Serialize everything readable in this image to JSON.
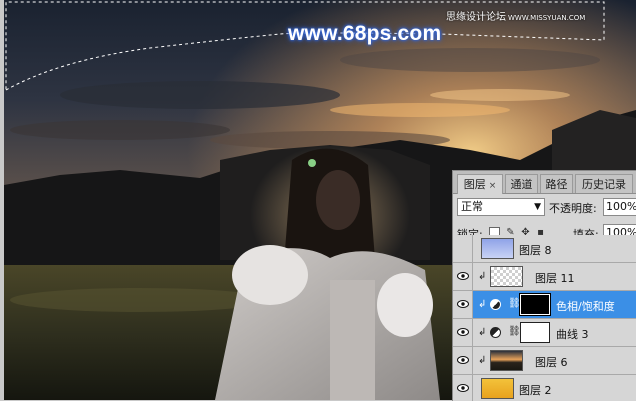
{
  "watermark": {
    "main": "www.68ps.com",
    "top_cn": "思缘设计论坛",
    "top_url": "WWW.MISSYUAN.COM"
  },
  "panel": {
    "tabs": [
      {
        "label": "图层",
        "close": "×",
        "active": true
      },
      {
        "label": "通道",
        "active": false
      },
      {
        "label": "路径",
        "active": false
      },
      {
        "label": "历史记录",
        "active": false
      }
    ],
    "blend_mode": "正常",
    "opacity_label": "不透明度:",
    "opacity_value": "100%",
    "lock_label": "锁定:",
    "fill_label": "填充:",
    "fill_value": "100%"
  },
  "layers": [
    {
      "name": "图层 8",
      "visible": false,
      "clipped": false,
      "type": "pixel"
    },
    {
      "name": "图层 11",
      "visible": true,
      "clipped": true,
      "type": "pixel"
    },
    {
      "name": "色相/饱和度",
      "visible": true,
      "clipped": true,
      "type": "adjustment",
      "selected": true
    },
    {
      "name": "曲线 3",
      "visible": true,
      "clipped": true,
      "type": "adjustment"
    },
    {
      "name": "图层 6",
      "visible": true,
      "clipped": true,
      "type": "pixel"
    },
    {
      "name": "图层 2",
      "visible": true,
      "clipped": false,
      "type": "pixel"
    }
  ],
  "colors": {
    "selection_highlight": "#3b8fe6",
    "panel_bg": "#d6d6d6"
  }
}
